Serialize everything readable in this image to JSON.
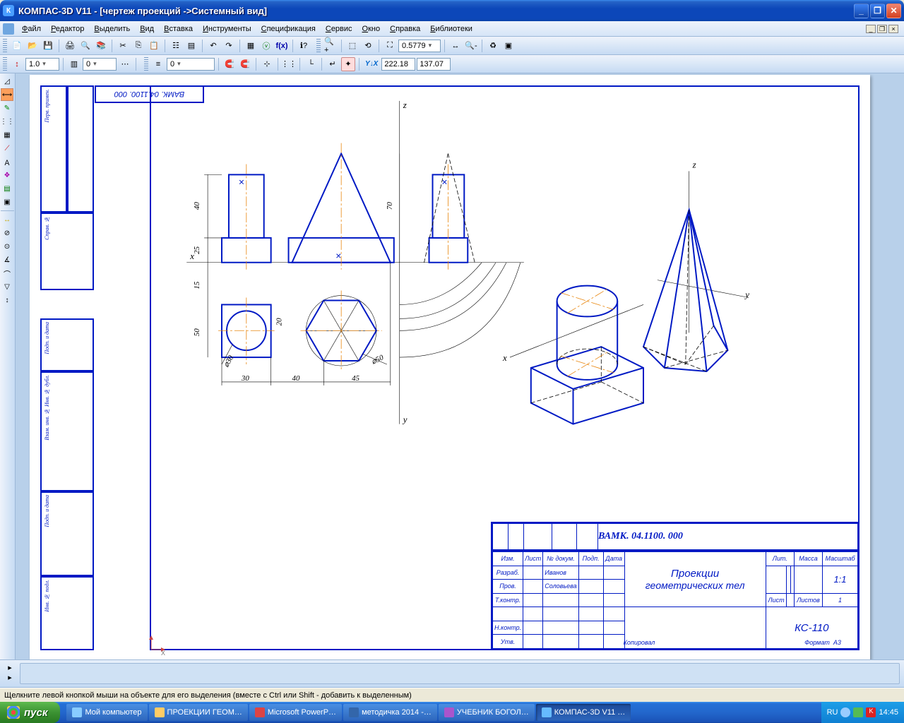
{
  "title": "КОМПАС-3D V11 - [чертеж проекций ->Системный вид]",
  "menu": [
    "Файл",
    "Редактор",
    "Выделить",
    "Вид",
    "Вставка",
    "Инструменты",
    "Спецификация",
    "Сервис",
    "Окно",
    "Справка",
    "Библиотеки"
  ],
  "toolbar1": {
    "zoom_value": "0.5779"
  },
  "toolbar2": {
    "step": "1.0",
    "layer": "0",
    "style": "0",
    "coord_x": "222.18",
    "coord_y": "137.07"
  },
  "drawing": {
    "top_code_reversed": "ВАМК. 04.1100. 000",
    "axes": {
      "x": "x",
      "y": "y",
      "z": "z"
    },
    "dims": {
      "d40": "40",
      "d25": "25",
      "d15": "15",
      "d50": "50",
      "d30": "30",
      "d40b": "40",
      "d45": "45",
      "d70": "70",
      "d20": "20",
      "dia30": "⌀30",
      "dia50": "⌀50"
    },
    "side_labels": {
      "perv": "Перв. примен.",
      "sprav": "Справ. №",
      "podp1": "Подп. и дата",
      "inv": "Взам. инв. №  Инв. № дубл.",
      "podp2": "Подп. и дата",
      "inv2": "Инв. № подл."
    }
  },
  "title_block": {
    "code": "ВАМК. 04.1100. 000",
    "name1": "Проекции",
    "name2": "геометрических тел",
    "group": "КС-110",
    "headers": {
      "izm": "Изм.",
      "list": "Лист",
      "ndokum": "№ докум.",
      "podp": "Подп.",
      "data": "Дата",
      "razrab": "Разраб.",
      "prov": "Пров.",
      "tkontr": "Т.контр.",
      "nkontr": "Н.контр.",
      "utv": "Утв.",
      "lit": "Лит.",
      "massa": "Масса",
      "masshtab": "Масштаб",
      "list2": "Лист",
      "listov": "Листов",
      "listov_n": "1",
      "scale": "1:1",
      "kopir": "Копировал",
      "format": "Формат",
      "a3": "А3"
    },
    "names": {
      "razrab": "Иванов",
      "prov": "Соловьева"
    }
  },
  "status": "Щелкните левой кнопкой мыши на объекте для его выделения (вместе с Ctrl или Shift - добавить к выделенным)",
  "taskbar": {
    "start": "пуск",
    "items": [
      "Мой компьютер",
      "ПРОЕКЦИИ ГЕОМ…",
      "Microsoft PowerP…",
      "методичка 2014 -…",
      "УЧЕБНИК БОГОЛ…",
      "КОМПАС-3D V11 …"
    ],
    "lang": "RU",
    "time": "14:45"
  }
}
